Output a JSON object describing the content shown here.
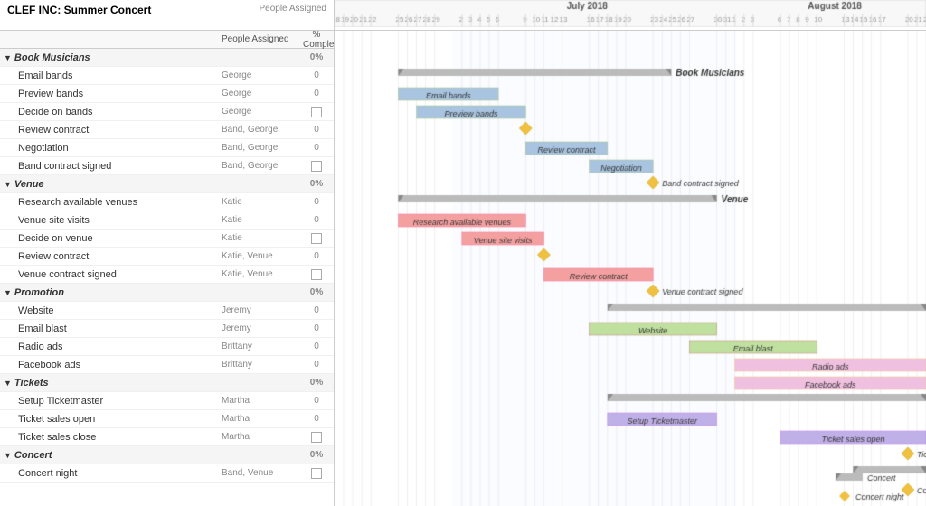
{
  "title": "CLEF INC: Summer Concert",
  "columns": {
    "people": "People Assigned",
    "complete": "% Complete"
  },
  "groups": [
    {
      "id": "book-musicians",
      "name": "Book Musicians",
      "complete": "0%",
      "tasks": [
        {
          "name": "Email bands",
          "assigned": "George",
          "complete": "0"
        },
        {
          "name": "Preview bands",
          "assigned": "George",
          "complete": "0"
        },
        {
          "name": "Decide on bands",
          "assigned": "George",
          "complete": "checkbox"
        },
        {
          "name": "Review contract",
          "assigned": "Band, George",
          "complete": "0"
        },
        {
          "name": "Negotiation",
          "assigned": "Band, George",
          "complete": "0"
        },
        {
          "name": "Band contract signed",
          "assigned": "Band, George",
          "complete": "checkbox"
        }
      ]
    },
    {
      "id": "venue",
      "name": "Venue",
      "complete": "0%",
      "tasks": [
        {
          "name": "Research available venues",
          "assigned": "Katie",
          "complete": "0"
        },
        {
          "name": "Venue site visits",
          "assigned": "Katie",
          "complete": "0"
        },
        {
          "name": "Decide on venue",
          "assigned": "Katie",
          "complete": "checkbox"
        },
        {
          "name": "Review contract",
          "assigned": "Katie, Venue",
          "complete": "0"
        },
        {
          "name": "Venue contract signed",
          "assigned": "Katie, Venue",
          "complete": "checkbox"
        }
      ]
    },
    {
      "id": "promotion",
      "name": "Promotion",
      "complete": "0%",
      "tasks": [
        {
          "name": "Website",
          "assigned": "Jeremy",
          "complete": "0"
        },
        {
          "name": "Email blast",
          "assigned": "Jeremy",
          "complete": "0"
        },
        {
          "name": "Radio ads",
          "assigned": "Brittany",
          "complete": "0"
        },
        {
          "name": "Facebook ads",
          "assigned": "Brittany",
          "complete": "0"
        }
      ]
    },
    {
      "id": "tickets",
      "name": "Tickets",
      "complete": "0%",
      "tasks": [
        {
          "name": "Setup Ticketmaster",
          "assigned": "Martha",
          "complete": "0"
        },
        {
          "name": "Ticket sales open",
          "assigned": "Martha",
          "complete": "0"
        },
        {
          "name": "Ticket sales close",
          "assigned": "Martha",
          "complete": "checkbox"
        }
      ]
    },
    {
      "id": "concert",
      "name": "Concert",
      "complete": "0%",
      "tasks": [
        {
          "name": "Concert night",
          "assigned": "Band, Venue",
          "complete": "checkbox"
        }
      ]
    }
  ]
}
